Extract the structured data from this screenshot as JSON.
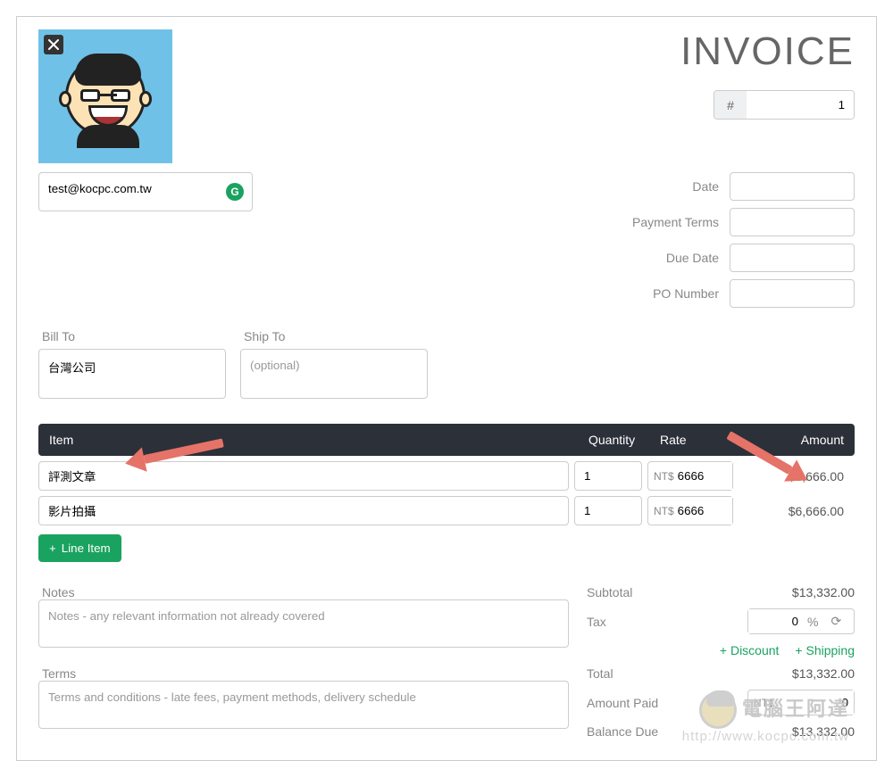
{
  "header": {
    "title": "INVOICE",
    "hash": "#",
    "number": "1"
  },
  "from": {
    "value": "test@kocpc.com.tw",
    "grammarly_icon": "G"
  },
  "meta": {
    "date_label": "Date",
    "date": "",
    "terms_label": "Payment Terms",
    "terms": "",
    "due_label": "Due Date",
    "due": "",
    "po_label": "PO Number",
    "po": ""
  },
  "billto": {
    "label": "Bill To",
    "value": "台灣公司"
  },
  "shipto": {
    "label": "Ship To",
    "placeholder": "(optional)",
    "value": ""
  },
  "columns": {
    "item": "Item",
    "qty": "Quantity",
    "rate": "Rate",
    "amount": "Amount"
  },
  "currency_prefix": "NT$",
  "lines": [
    {
      "item": "評測文章",
      "qty": "1",
      "rate": "6666",
      "amount": "$6,666.00"
    },
    {
      "item": "影片拍攝",
      "qty": "1",
      "rate": "6666",
      "amount": "$6,666.00"
    }
  ],
  "add_line": "Line Item",
  "notes": {
    "label": "Notes",
    "placeholder": "Notes - any relevant information not already covered"
  },
  "terms_section": {
    "label": "Terms",
    "placeholder": "Terms and conditions - late fees, payment methods, delivery schedule"
  },
  "totals": {
    "subtotal_label": "Subtotal",
    "subtotal": "$13,332.00",
    "tax_label": "Tax",
    "tax_value": "0",
    "tax_suffix": "%",
    "discount": "Discount",
    "shipping": "Shipping",
    "total_label": "Total",
    "total": "$13,332.00",
    "paid_label": "Amount Paid",
    "paid_prefix": "NT$",
    "paid_value": "0",
    "balance_label": "Balance Due",
    "balance": "$13,332.00"
  },
  "watermark": {
    "brand": "電腦王阿達",
    "url": "http://www.kocpc.com.tw"
  }
}
